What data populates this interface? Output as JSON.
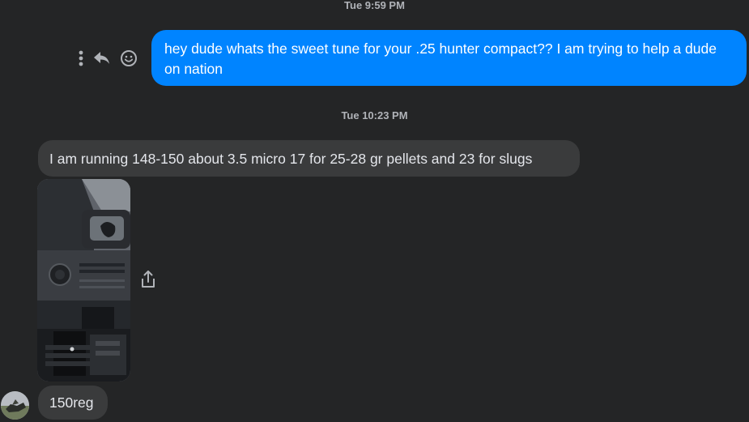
{
  "conversation": {
    "timestamp_1": "Tue 9:59 PM",
    "timestamp_2": "Tue 10:23 PM"
  },
  "outgoing_message": {
    "text": "hey dude whats the sweet tune for your .25 hunter compact?? I am trying to help a dude on nation",
    "bubble_color": "#0084ff"
  },
  "message_actions": {
    "icons": [
      "more-options-icon",
      "reply-icon",
      "react-emoji-icon"
    ]
  },
  "incoming_messages": {
    "text_1": "I am running 148-150 about 3.5 micro 17 for 25-28 gr pellets and 23 for slugs",
    "text_2": "150reg",
    "bubble_color": "#3a3b3c"
  },
  "attachment": {
    "share_icon": "share-icon"
  }
}
